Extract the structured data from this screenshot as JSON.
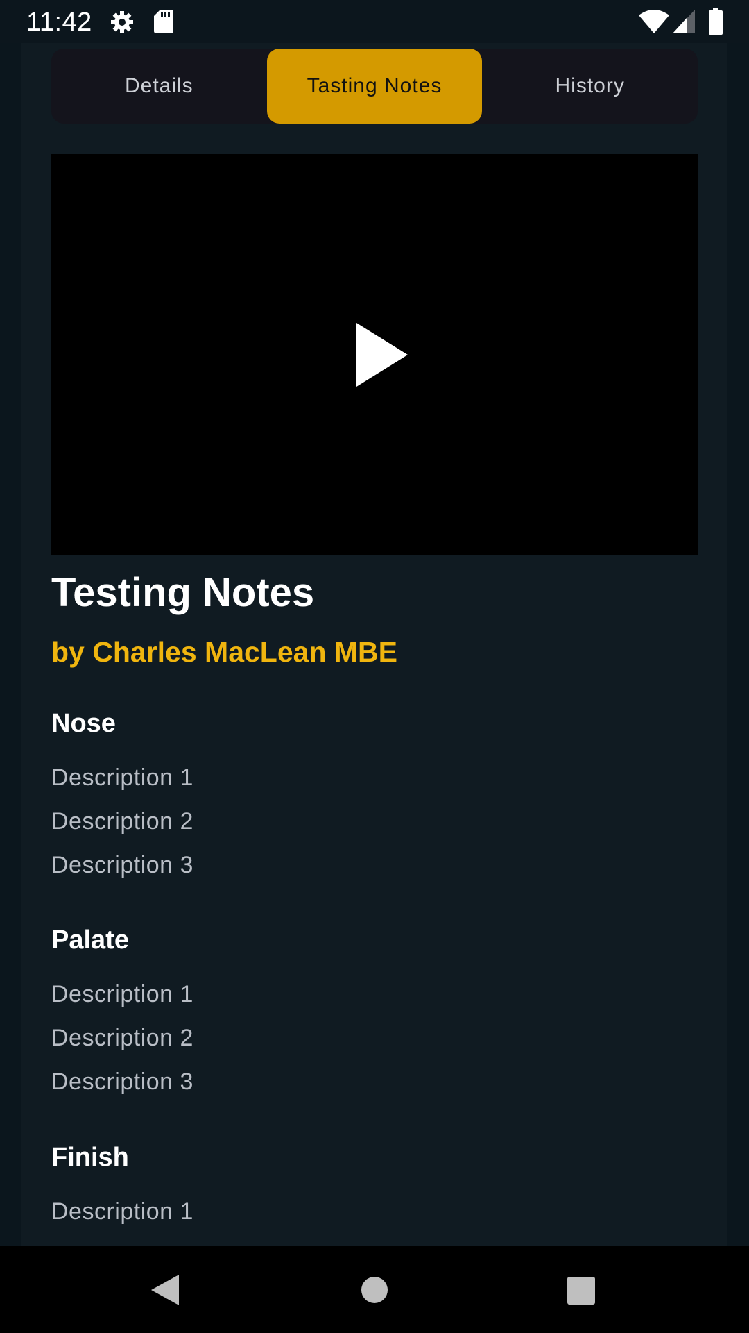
{
  "status_bar": {
    "time": "11:42",
    "icons": [
      "settings-icon",
      "sd-card-icon",
      "wifi-icon",
      "cell-signal-icon",
      "battery-icon"
    ]
  },
  "tabs": [
    {
      "label": "Details",
      "active": false
    },
    {
      "label": "Tasting Notes",
      "active": true
    },
    {
      "label": "History",
      "active": false
    }
  ],
  "video": {
    "icon": "play-icon"
  },
  "content": {
    "title": "Testing Notes",
    "author": "by Charles MacLean MBE",
    "sections": [
      {
        "heading": "Nose",
        "items": [
          "Description 1",
          "Description 2",
          "Description 3"
        ]
      },
      {
        "heading": "Palate",
        "items": [
          "Description 1",
          "Description 2",
          "Description 3"
        ]
      },
      {
        "heading": "Finish",
        "items": [
          "Description 1"
        ]
      }
    ]
  },
  "nav_bar": {
    "icons": [
      "back-icon",
      "home-icon",
      "recents-icon"
    ]
  },
  "colors": {
    "accent": "#d49a00",
    "author": "#f0b50f",
    "background": "#101b22"
  }
}
